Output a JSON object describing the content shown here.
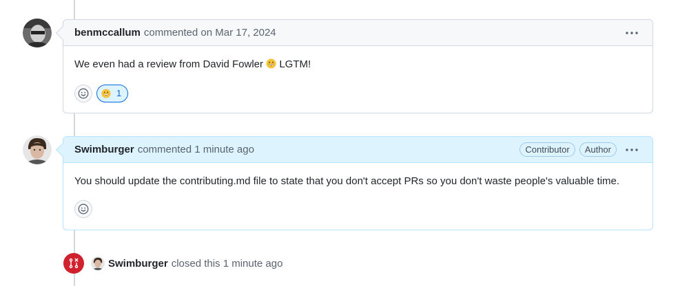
{
  "comments": [
    {
      "author": "benmccallum",
      "meta": "commented on Mar 17, 2024",
      "body_before": "We even had a review from David Fowler ",
      "body_after": " LGTM!",
      "reaction_count": "1"
    },
    {
      "author": "Swimburger",
      "meta": "commented 1 minute ago",
      "badges": [
        "Contributor",
        "Author"
      ],
      "body": "You should update the contributing.md file to state that you don't accept PRs so you don't waste people's valuable time."
    }
  ],
  "event": {
    "actor": "Swimburger",
    "text": "closed this 1 minute ago"
  },
  "icons": {
    "more": "kebab-horizontal-icon",
    "add_reaction": "smiley-icon",
    "reaction": "grinning-face-emoji",
    "closed": "git-pull-request-closed-icon"
  },
  "colors": {
    "closed": "#cf222e",
    "highlight_header": "#ddf4ff",
    "link": "#0969da"
  }
}
